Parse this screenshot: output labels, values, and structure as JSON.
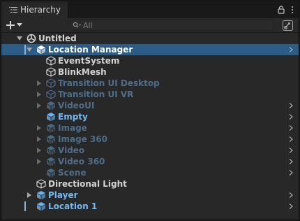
{
  "window": {
    "tab_title": "Hierarchy"
  },
  "toolbar": {
    "search_placeholder": "All"
  },
  "tree": [
    {
      "label": "Untitled",
      "style": "light",
      "icon": "unity-scene-icon",
      "expanded": true
    },
    {
      "label": "Location Manager",
      "style": "white",
      "icon": "prefab-icon",
      "expanded": true,
      "selected": true,
      "chevron": true
    },
    {
      "label": "EventSystem",
      "style": "light",
      "icon": "gameobject-icon"
    },
    {
      "label": "BlinkMesh",
      "style": "light",
      "icon": "gameobject-icon"
    },
    {
      "label": "Transition UI Desktop",
      "style": "dim",
      "icon": "gameobject-icon",
      "expandable": true
    },
    {
      "label": "Transition UI VR",
      "style": "dim",
      "icon": "gameobject-icon",
      "expandable": true
    },
    {
      "label": "VideoUI",
      "style": "dim",
      "icon": "prefab-icon",
      "expandable": true,
      "chevron": true
    },
    {
      "label": "Empty",
      "style": "blue",
      "icon": "prefab-icon",
      "chevron": true
    },
    {
      "label": "Image",
      "style": "dim",
      "icon": "prefab-variant-icon",
      "expandable": true,
      "chevron": true
    },
    {
      "label": "Image 360",
      "style": "dim",
      "icon": "prefab-variant-icon",
      "expandable": true,
      "chevron": true
    },
    {
      "label": "Video",
      "style": "dim",
      "icon": "prefab-variant-icon",
      "expandable": true,
      "chevron": true
    },
    {
      "label": "Video 360",
      "style": "dim",
      "icon": "prefab-variant-icon",
      "expandable": true,
      "chevron": true
    },
    {
      "label": "Scene",
      "style": "dim",
      "icon": "prefab-icon",
      "chevron": true
    },
    {
      "label": "Directional Light",
      "style": "light",
      "icon": "gameobject-icon"
    },
    {
      "label": "Player",
      "style": "blue",
      "icon": "prefab-icon",
      "expandable": true,
      "chevron": true
    },
    {
      "label": "Location 1",
      "style": "blue",
      "icon": "prefab-icon",
      "chevron": true
    }
  ],
  "colors": {
    "selection": "#2c5d87",
    "prefab_text": "#75b8f0",
    "inactive_text": "#4f6d88",
    "panel_bg": "#282828"
  }
}
